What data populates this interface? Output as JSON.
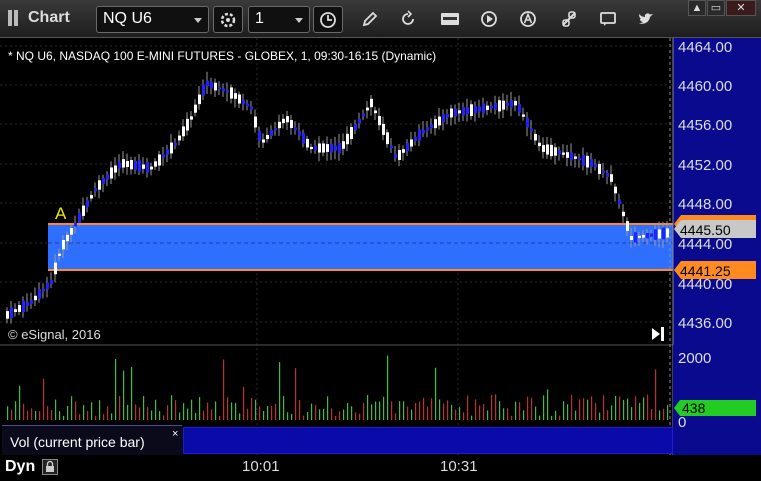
{
  "toolbar": {
    "title": "Chart",
    "symbol": "NQ U6",
    "interval": "1",
    "window_buttons": [
      "▲",
      "▭",
      "✕"
    ]
  },
  "chart": {
    "header": "* NQ U6, NASDAQ 100 E-MINI FUTURES - GLOBEX, 1, 09:30-16:15 (Dynamic)",
    "watermark": "© eSignal, 2016",
    "marker_label": "A",
    "price_labels": [
      "4464.00",
      "4460.00",
      "4456.00",
      "4452.00",
      "4448.00",
      "4444.00",
      "4440.00",
      "4436.00"
    ],
    "tag_upper": "4445.50",
    "tag_upper_partial": "4446.00",
    "tag_lower": "4441.25",
    "volume_labels": [
      "2000",
      "0"
    ],
    "volume_tag": "438",
    "time_labels": [
      "10:01",
      "10:31"
    ],
    "study_label": "Vol (current price bar)",
    "study_close": "×",
    "mode_label": "Dyn",
    "colors": {
      "zone": "#2f6fff",
      "zone_border": "#ff8a20",
      "up": "#ffffff",
      "down": "#2222ff",
      "vol_up": "#3fbf3f",
      "vol_down": "#bf2f2f",
      "tag_green": "#22cc22"
    }
  }
}
